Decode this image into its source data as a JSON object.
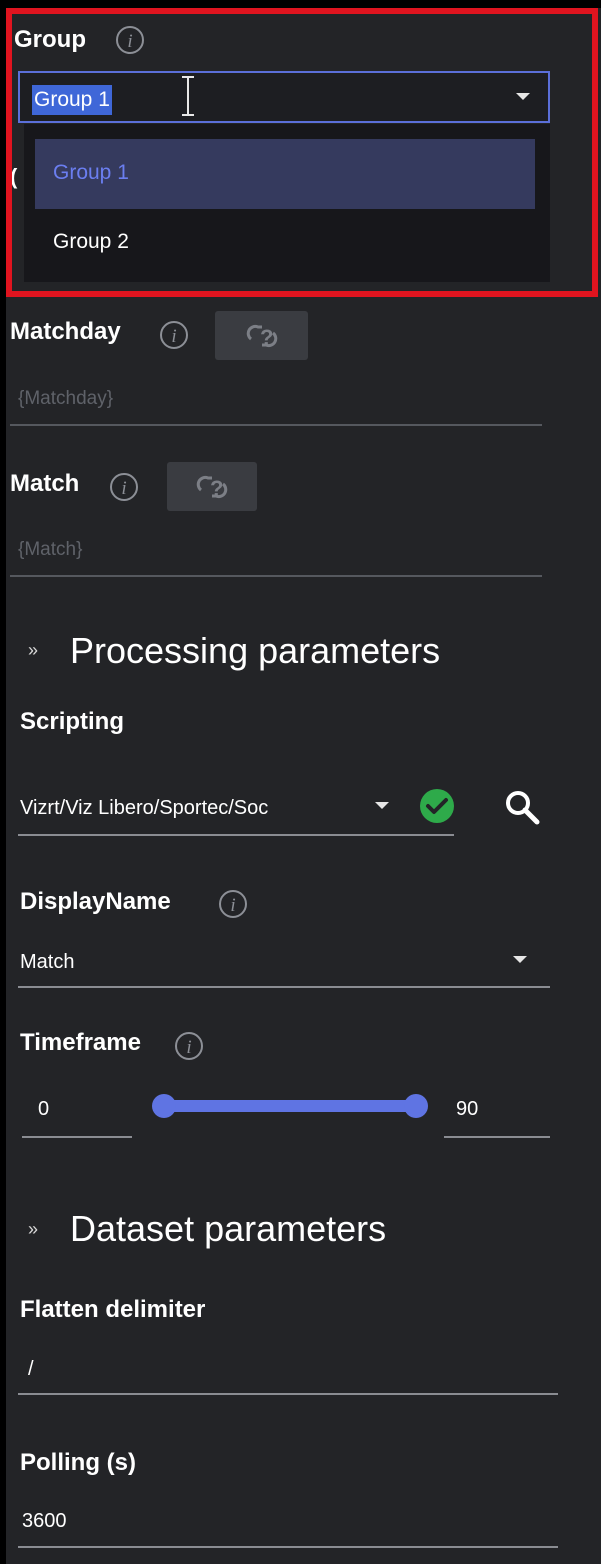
{
  "group": {
    "label": "Group",
    "info_glyph": "i",
    "selected": "Group 1",
    "options": [
      {
        "label": "Group 1",
        "selected": true
      },
      {
        "label": "Group 2",
        "selected": false
      }
    ]
  },
  "hidden_label_fragment": "(",
  "matchday": {
    "label": "Matchday",
    "info_glyph": "i",
    "placeholder": "{Matchday}"
  },
  "match": {
    "label": "Match",
    "info_glyph": "i",
    "placeholder": "{Match}"
  },
  "processing": {
    "title": "Processing parameters",
    "chevron": "»"
  },
  "scripting": {
    "label": "Scripting",
    "value": "Vizrt/Viz Libero/Sportec/Soc"
  },
  "display_name": {
    "label": "DisplayName",
    "info_glyph": "i",
    "value": "Match"
  },
  "timeframe": {
    "label": "Timeframe",
    "info_glyph": "i",
    "min": "0",
    "max": "90",
    "range": {
      "low": 0,
      "high": 90
    }
  },
  "dataset": {
    "title": "Dataset parameters",
    "chevron": "»"
  },
  "flatten": {
    "label": "Flatten delimiter",
    "value": "/"
  },
  "polling": {
    "label": "Polling (s)",
    "value": "3600"
  },
  "colors": {
    "accent": "#5f74e3",
    "highlight_box": "#e0141f",
    "success": "#2eaa4a",
    "panel": "#232427",
    "dropdown_bg": "#17171b",
    "option_selected_bg": "#353a5e"
  }
}
